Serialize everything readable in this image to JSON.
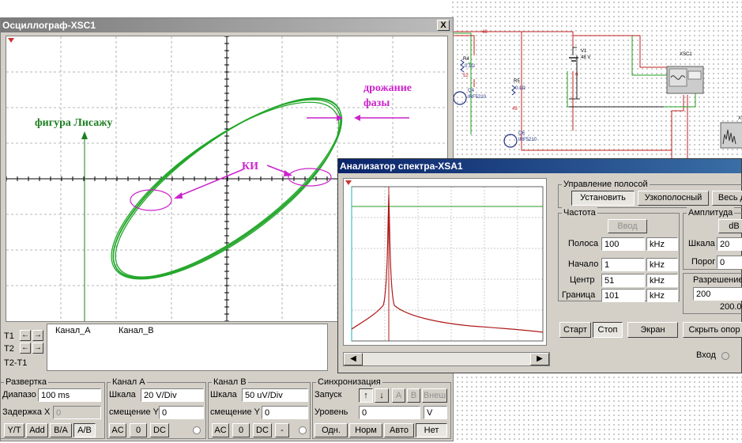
{
  "colors": {
    "trace_green": "#22a62a",
    "annot_magenta": "#cc22cc",
    "annot_green": "#1d7f22",
    "spectrum_red": "#b01a1a",
    "titlebar_active": "#0a246a"
  },
  "schematic": {
    "labels": [
      {
        "text": "48"
      },
      {
        "text": "R4"
      },
      {
        "text": "0.1Ω"
      },
      {
        "text": "52"
      },
      {
        "text": "Q4"
      },
      {
        "text": "IRF5210"
      },
      {
        "text": "R5"
      },
      {
        "text": "0.1Ω"
      },
      {
        "text": "49"
      },
      {
        "text": "Q6"
      },
      {
        "text": "IRF5210"
      },
      {
        "text": "V1"
      },
      {
        "text": "48 V"
      },
      {
        "text": "0"
      },
      {
        "text": "XSC1"
      },
      {
        "text": "XS"
      }
    ]
  },
  "oscilloscope": {
    "title": "Осциллограф-XSC1",
    "close": "X",
    "annotations": {
      "lissajous": "фигура Лисажу",
      "phase_jitter_1": "дрожание",
      "phase_jitter_2": "фазы",
      "ki": "КИ"
    },
    "cursor_rows": [
      {
        "label": "T1",
        "left": "←",
        "right": "→"
      },
      {
        "label": "T2",
        "left": "←",
        "right": "→"
      },
      {
        "label": "T2-T1"
      }
    ],
    "readout_headers": [
      "Канал_A",
      "Канал_B"
    ],
    "timebase": {
      "group": "Развертка",
      "range_label": "Диапазо",
      "range_value": "100 ms",
      "delay_label": "Задержка X",
      "delay_value": "0",
      "buttons": [
        "Y/T",
        "Add",
        "B/A",
        "A/B"
      ]
    },
    "channel_a": {
      "group": "Канал A",
      "scale_label": "Шкала",
      "scale_value": "20  V/Div",
      "offset_label": "смещение Y",
      "offset_value": "0",
      "buttons": [
        "AC",
        "0",
        "DC"
      ]
    },
    "channel_b": {
      "group": "Канал B",
      "scale_label": "Шкала",
      "scale_value": "50 uV/Div",
      "offset_label": "смещение Y",
      "offset_value": "0",
      "buttons": [
        "AC",
        "0",
        "DC",
        "-"
      ]
    },
    "trigger": {
      "group": "Синхронизация",
      "start_label": "Запуск",
      "edge_buttons": [
        "↑",
        "↓"
      ],
      "source_buttons": [
        "A",
        "B",
        "Внеш"
      ],
      "level_label": "Уровень",
      "level_value": "0",
      "level_unit": "V",
      "mode_buttons": [
        "Одн.",
        "Норм",
        "Авто",
        "Нет"
      ]
    }
  },
  "spectrum": {
    "title": "Анализатор спектра-XSA1",
    "scroll_left": "◀",
    "scroll_right": "▶",
    "band_group": "Управление полосой",
    "band_buttons": [
      "Установить",
      "Узкополосный",
      "Весь д"
    ],
    "frequency": {
      "group": "Частота",
      "enter_button": "Ввод",
      "rows": [
        {
          "label": "Полоса",
          "value": "100",
          "unit": "kHz"
        },
        {
          "label": "Начало",
          "value": "1",
          "unit": "kHz"
        },
        {
          "label": "Центр",
          "value": "51",
          "unit": "kHz"
        },
        {
          "label": "Граница",
          "value": "101",
          "unit": "kHz"
        }
      ]
    },
    "amplitude": {
      "group": "Амплитуда",
      "unit_button": "dB",
      "scale_label": "Шкала",
      "scale_value": "20",
      "threshold_label": "Порог",
      "threshold_value": "0"
    },
    "resolution": {
      "label": "Разрешение",
      "value": "200",
      "readout": "200.0"
    },
    "bottom_buttons": [
      "Старт",
      "Стоп",
      "Экран",
      "Скрыть опор"
    ],
    "input_label": "Вход"
  }
}
